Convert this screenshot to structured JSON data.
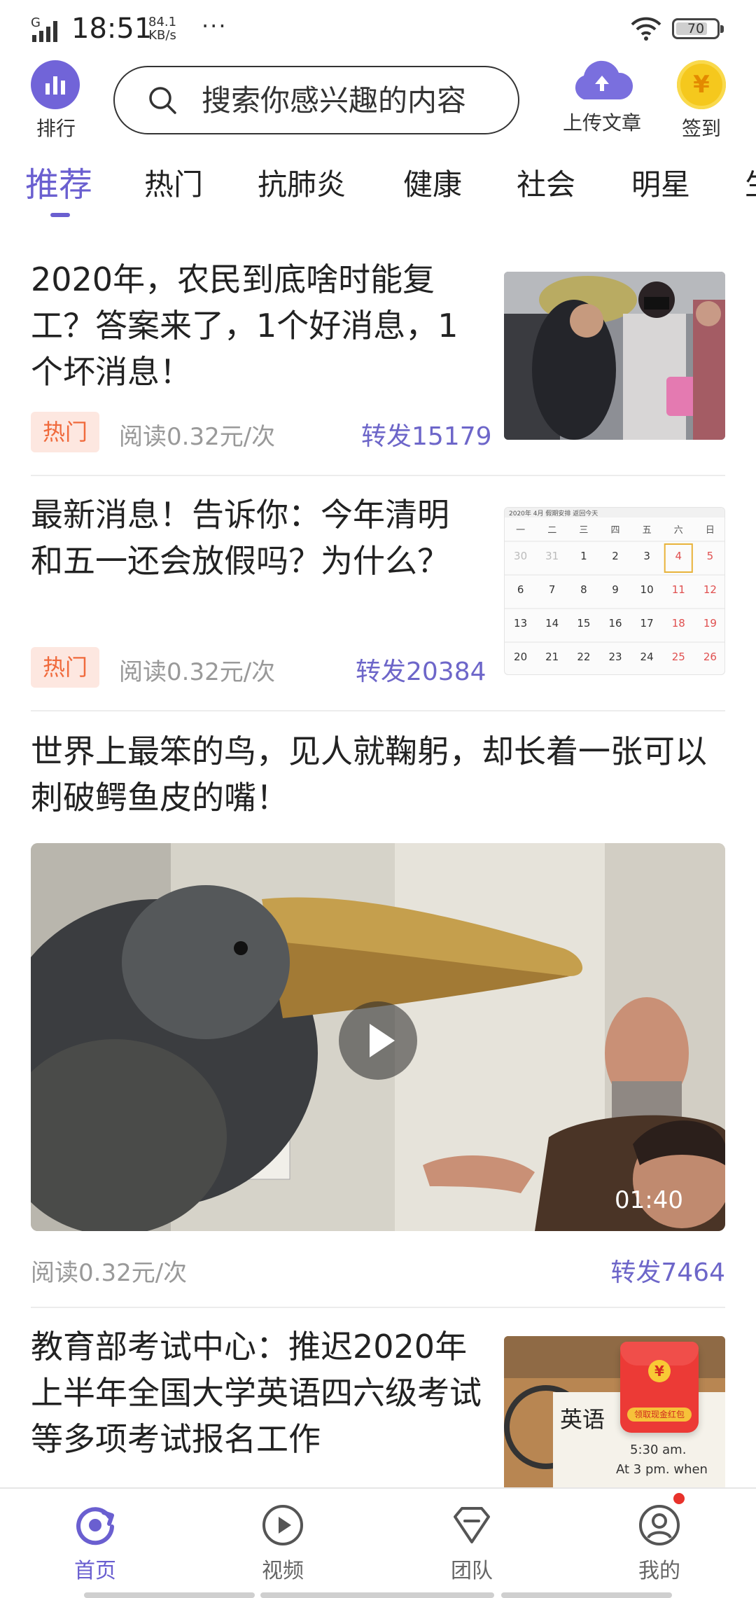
{
  "status_bar": {
    "network": "G",
    "time": "18:51",
    "speed_value": "84.1",
    "speed_unit": "KB/s",
    "more": "···",
    "battery": "70"
  },
  "header": {
    "rank_label": "排行",
    "search_placeholder": "搜索你感兴趣的内容",
    "upload_label": "上传文章",
    "signin_label": "签到",
    "coin_symbol": "¥"
  },
  "tabs": [
    "推荐",
    "热门",
    "抗肺炎",
    "健康",
    "社会",
    "明星",
    "生"
  ],
  "articles": [
    {
      "title": "2020年，农民到底啥时能复工？答案来了，1个好消息，1个坏消息！",
      "badge": "热门",
      "read": "阅读0.32元/次",
      "share": "转发15179"
    },
    {
      "title": "最新消息！告诉你：今年清明和五一还会放假吗？为什么？",
      "badge": "热门",
      "read": "阅读0.32元/次",
      "share": "转发20384"
    },
    {
      "title": "世界上最笨的鸟，见人就鞠躬，却长着一张可以刺破鳄鱼皮的嘴！",
      "duration": "01:40",
      "read": "阅读0.32元/次",
      "share": "转发7464"
    },
    {
      "title": "教育部考试中心：推迟2020年上半年全国大学英语四六级考试等多项考试报名工作"
    }
  ],
  "calendar": {
    "header": "2020年 4月 假期安排 返回今天",
    "weekdays": [
      "一",
      "二",
      "三",
      "四",
      "五",
      "六",
      "日"
    ],
    "rows": [
      [
        "30",
        "31",
        "1",
        "2",
        "3",
        "4",
        "5"
      ],
      [
        "6",
        "7",
        "8",
        "9",
        "10",
        "11",
        "12"
      ],
      [
        "13",
        "14",
        "15",
        "16",
        "17",
        "18",
        "19"
      ],
      [
        "20",
        "21",
        "22",
        "23",
        "24",
        "25",
        "26"
      ]
    ]
  },
  "english_thumb": {
    "sign_text": "英语",
    "time_text": "5:30 am.",
    "time_text2": "At 3 pm. when"
  },
  "redpack": {
    "seal": "¥",
    "caption": "领取现金红包"
  },
  "bottom_nav": [
    {
      "label": "首页"
    },
    {
      "label": "视频"
    },
    {
      "label": "团队"
    },
    {
      "label": "我的"
    }
  ]
}
